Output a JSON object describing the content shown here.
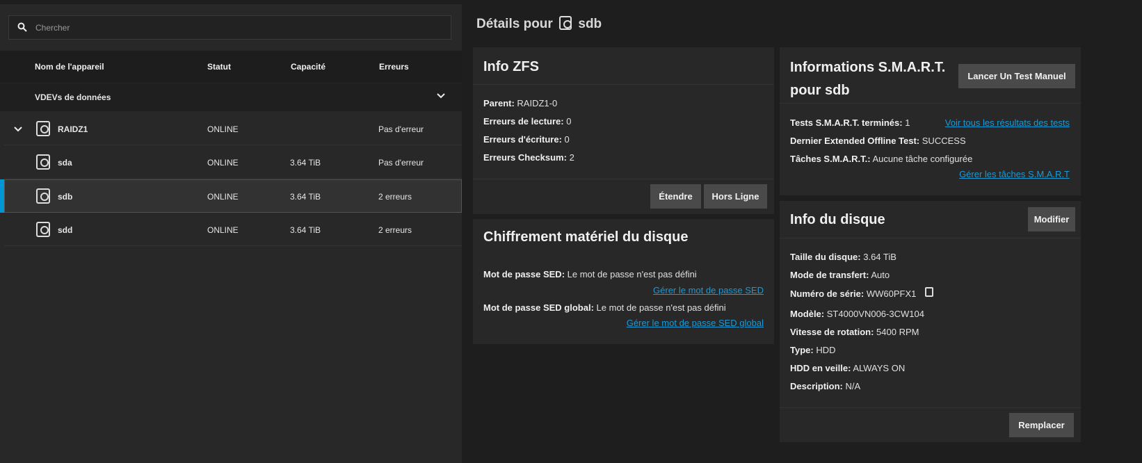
{
  "search": {
    "placeholder": "Chercher"
  },
  "table": {
    "columns": [
      "Nom de l'appareil",
      "Statut",
      "Capacité",
      "Erreurs"
    ],
    "group_label": "VDEVs de données",
    "rows": [
      {
        "name": "RAIDZ1",
        "status": "ONLINE",
        "capacity": "",
        "errors": "Pas d'erreur"
      },
      {
        "name": "sda",
        "status": "ONLINE",
        "capacity": "3.64 TiB",
        "errors": "Pas d'erreur"
      },
      {
        "name": "sdb",
        "status": "ONLINE",
        "capacity": "3.64 TiB",
        "errors": "2 erreurs"
      },
      {
        "name": "sdd",
        "status": "ONLINE",
        "capacity": "3.64 TiB",
        "errors": "2 erreurs"
      }
    ]
  },
  "details": {
    "prefix": "Détails pour",
    "device": "sdb"
  },
  "zfs": {
    "title": "Info ZFS",
    "items": [
      {
        "label": "Parent:",
        "value": "RAIDZ1-0"
      },
      {
        "label": "Erreurs de lecture:",
        "value": "0"
      },
      {
        "label": "Erreurs d'écriture:",
        "value": "0"
      },
      {
        "label": "Erreurs Checksum:",
        "value": "2"
      }
    ],
    "extend_label": "Étendre",
    "offline_label": "Hors Ligne"
  },
  "sed": {
    "title": "Chiffrement matériel du disque",
    "password_label": "Mot de passe SED:",
    "password_value": "Le mot de passe n'est pas défini",
    "manage_link": "Gérer le mot de passe SED",
    "global_label": "Mot de passe SED global:",
    "global_value": "Le mot de passe n'est pas défini",
    "manage_global_link": "Gérer le mot de passe SED global"
  },
  "smart": {
    "title_line1": "Informations S.M.A.R.T.",
    "title_line2": "pour sdb",
    "run_test_label": "Lancer Un Test Manuel",
    "completed_label": "Tests S.M.A.R.T. terminés:",
    "completed_value": "1",
    "view_all_link": "Voir tous les résultats des tests",
    "last_label": "Dernier Extended Offline Test:",
    "last_value": "SUCCESS",
    "tasks_label": "Tâches S.M.A.R.T.:",
    "tasks_value": "Aucune tâche configurée",
    "manage_tasks_link": "Gérer les tâches S.M.A.R.T"
  },
  "disk_info": {
    "title": "Info du disque",
    "edit_label": "Modifier",
    "items": [
      {
        "label": "Taille du disque:",
        "value": "3.64 TiB"
      },
      {
        "label": "Mode de transfert:",
        "value": "Auto"
      },
      {
        "label": "Numéro de série:",
        "value": "WW60PFX1"
      },
      {
        "label": "Modèle:",
        "value": "ST4000VN006-3CW104"
      },
      {
        "label": "Vitesse de rotation:",
        "value": "5400 RPM"
      },
      {
        "label": "Type:",
        "value": "HDD"
      },
      {
        "label": "HDD en veille:",
        "value": "ALWAYS ON"
      },
      {
        "label": "Description:",
        "value": "N/A"
      }
    ],
    "replace_label": "Remplacer"
  }
}
